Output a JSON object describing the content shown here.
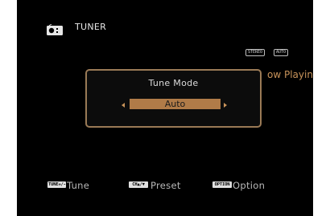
{
  "source": {
    "title": "TUNER",
    "icon": "radio-icon"
  },
  "status_badges": [
    "STEREO",
    "AUTO"
  ],
  "background_text": "ow Playing",
  "popup": {
    "title": "Tune Mode",
    "value": "Auto",
    "left_arrow_icon": "arrow-left-icon",
    "right_arrow_icon": "arrow-right-icon"
  },
  "footer": {
    "items": [
      {
        "key": "TUNE+/-",
        "label": "Tune"
      },
      {
        "key": "CH▲/▼",
        "label": "Preset"
      },
      {
        "key": "OPTION",
        "label": "Option"
      }
    ]
  },
  "colors": {
    "accent": "#b07b48",
    "accent_text": "#c8935a",
    "popup_border": "#9a7a56",
    "screen_bg": "#000000"
  }
}
